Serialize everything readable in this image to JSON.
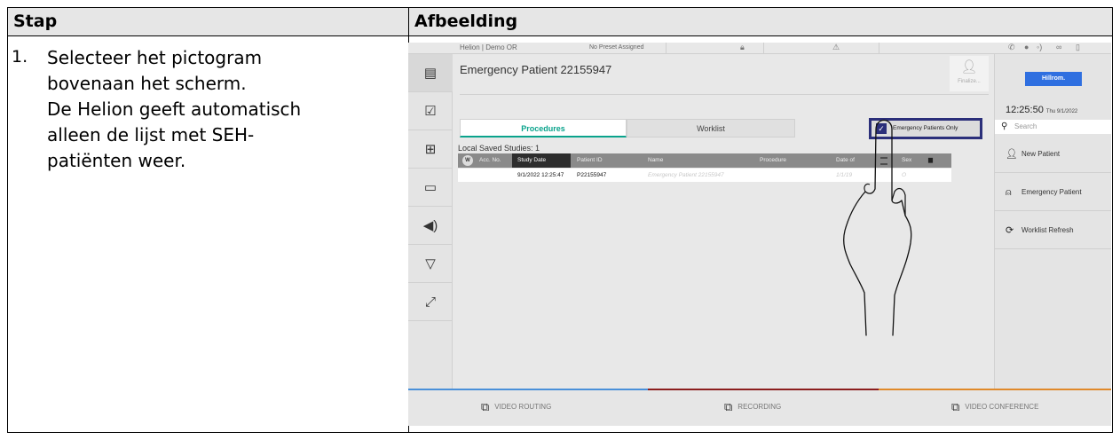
{
  "table": {
    "col_step": "Stap",
    "col_image": "Afbeelding",
    "step_number": "1.",
    "step_text": "Selecteer het pictogram\nbovenaan het scherm.\nDe Helion geeft automatisch\nalleen de lijst met SEH-\npatiënten weer."
  },
  "app": {
    "topbar": {
      "room": "Helion | Demo OR",
      "preset": "No Preset Assigned"
    },
    "title": "Emergency Patient 22155947",
    "finalize_label": "Finalize...",
    "tabs": [
      {
        "label": "Procedures",
        "active": true
      },
      {
        "label": "Worklist",
        "active": false
      }
    ],
    "emergency_filter": {
      "label": "Emergency Patients Only",
      "checked": true
    },
    "saved_studies": "Local Saved Studies: 1",
    "columns": {
      "w": "W",
      "acc": "Acc. No.",
      "study_date": "Study Date",
      "patient_id": "Patient ID",
      "name": "Name",
      "procedure": "Procedure",
      "dob": "Date of",
      "sex": "Sex"
    },
    "rows": [
      {
        "study_date": "9/1/2022 12:25:47",
        "patient_id": "P22155947",
        "name": "Emergency Patient 22155947",
        "dob": "1/1/19",
        "sex": "O"
      }
    ],
    "right_panel": {
      "logo": "Hillrom.",
      "time": "12:25:50",
      "date": "Thu 9/1/2022",
      "search_placeholder": "Search",
      "buttons": [
        "New Patient",
        "Emergency Patient",
        "Worklist Refresh"
      ]
    },
    "bottom": {
      "video_routing": "VIDEO ROUTING",
      "recording": "RECORDING",
      "video_conference": "VIDEO CONFERENCE"
    },
    "icons": {
      "sidebar": [
        "patient-card-icon",
        "checklist-icon",
        "device-tree-icon",
        "display-icon",
        "speaker-icon",
        "surgical-light-icon",
        "camera-icon"
      ]
    },
    "colors": {
      "accent_teal": "#0aa38c",
      "highlight_navy": "#2b2f7a",
      "bottom_blue": "#4a90d9",
      "bottom_red": "#8b1e1e",
      "bottom_orange": "#e0892a"
    }
  }
}
